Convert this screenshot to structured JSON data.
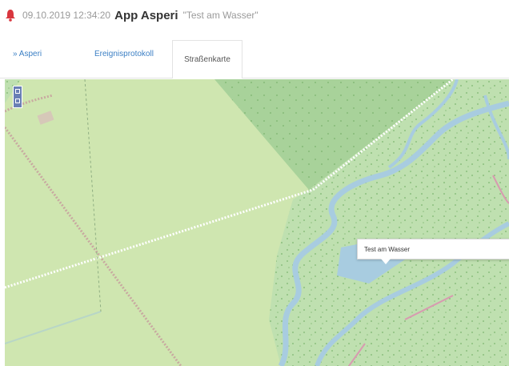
{
  "header": {
    "timestamp": "09.10.2019 12:34:20",
    "app": "App Asperi",
    "name": "\"Test am Wasser\""
  },
  "tabs": {
    "back_label": "» Asperi",
    "tab1_label": "Ereignisprotokoll",
    "tab2_label": "Straßenkarte"
  },
  "map": {
    "popup_text": "Test am Wasser",
    "colors": {
      "meadow": "#cfe6b0",
      "forest": "#bfe0b0",
      "dark_forest": "#a8d29a",
      "water": "#a8cce0",
      "path": "#c8a9a0",
      "accent": "#3b7fc4",
      "bell": "#d9363e"
    }
  }
}
